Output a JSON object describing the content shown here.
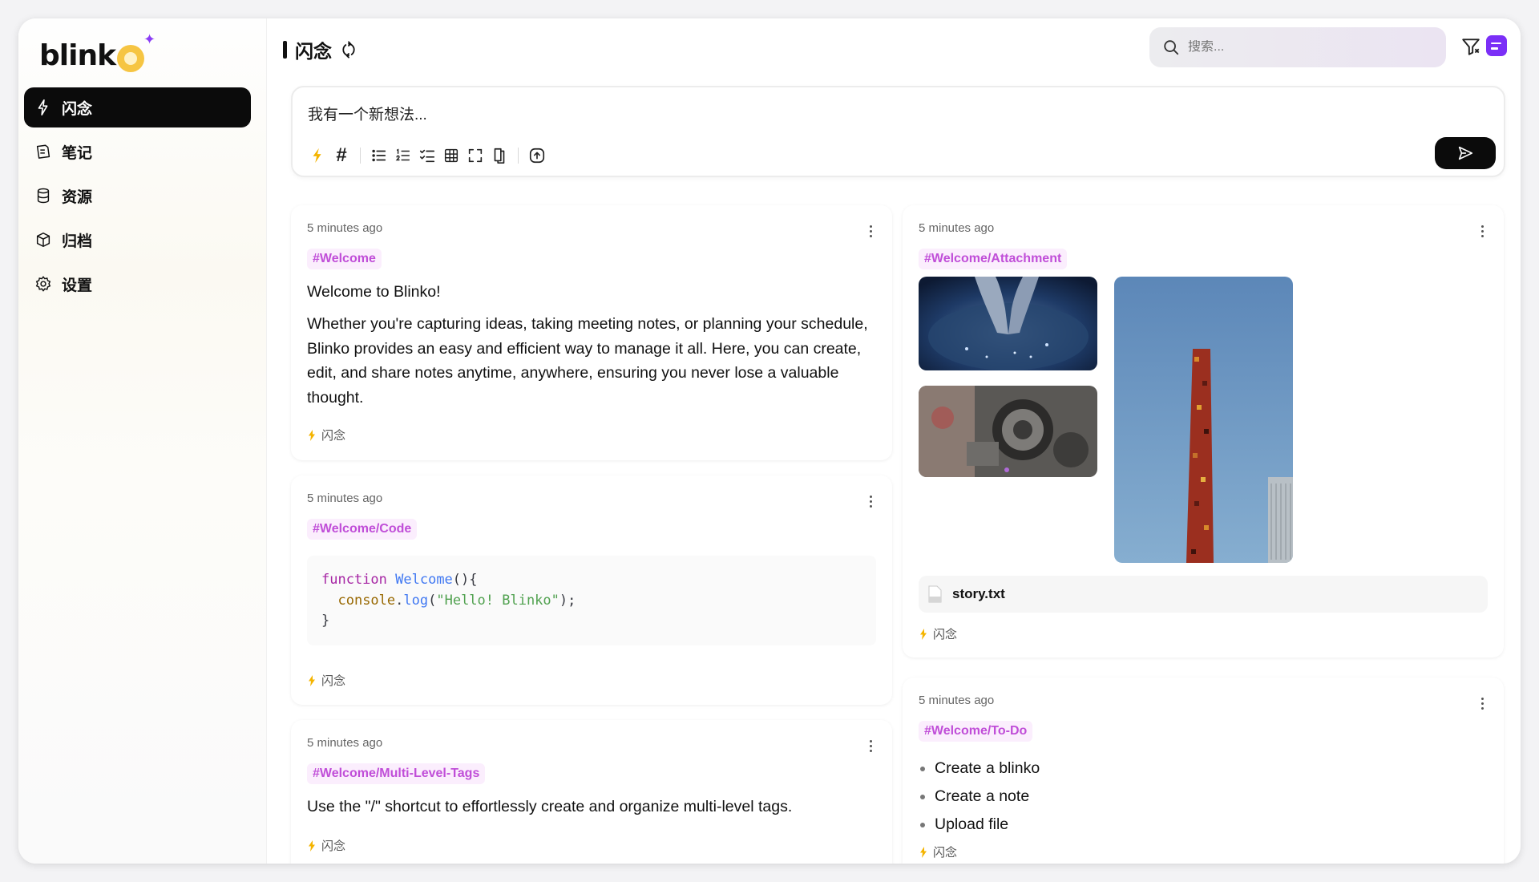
{
  "app": {
    "logo": "blinko"
  },
  "sidebar": {
    "items": [
      {
        "label": "闪念",
        "icon": "flash-icon",
        "active": true
      },
      {
        "label": "笔记",
        "icon": "notes-icon",
        "active": false
      },
      {
        "label": "资源",
        "icon": "database-icon",
        "active": false
      },
      {
        "label": "归档",
        "icon": "archive-box-icon",
        "active": false
      },
      {
        "label": "设置",
        "icon": "gear-icon",
        "active": false
      }
    ]
  },
  "header": {
    "title": "闪念",
    "search_placeholder": "搜索..."
  },
  "editor": {
    "placeholder": "我有一个新想法...",
    "tag_symbol": "#"
  },
  "cards": [
    {
      "time": "5 minutes ago",
      "tag": "#Welcome",
      "title": "Welcome to Blinko!",
      "body": "Whether you're capturing ideas, taking meeting notes, or planning your schedule, Blinko provides an easy and efficient way to manage it all. Here, you can create, edit, and share notes anytime, anywhere, ensuring you never lose a valuable thought.",
      "footer": "闪念"
    },
    {
      "time": "5 minutes ago",
      "tag": "#Welcome/Code",
      "code": {
        "line1_kw": "function",
        "line1_fn": "Welcome",
        "line1_rest": "(){",
        "line2_obj": "console",
        "line2_dot": ".",
        "line2_fn": "log",
        "line2_open": "(",
        "line2_str": "\"Hello! Blinko\"",
        "line2_close": ");",
        "line3": "}"
      },
      "footer": "闪念"
    },
    {
      "time": "5 minutes ago",
      "tag": "#Welcome/Multi-Level-Tags",
      "body": "Use the \"/\" shortcut to effortlessly create and organize multi-level tags.",
      "footer": "闪念"
    },
    {
      "time": "5 minutes ago",
      "tag": "#Welcome/Attachment",
      "attachment": "story.txt",
      "footer": "闪念"
    },
    {
      "time": "5 minutes ago",
      "tag": "#Welcome/To-Do",
      "todos": [
        "Create a blinko",
        "Create a note",
        "Upload file"
      ],
      "footer": "闪念"
    }
  ],
  "colors": {
    "accent": "#7b2ff7",
    "tag_text": "#c04ed8",
    "tag_bg": "#fbeefd",
    "flash": "#f4b400"
  }
}
